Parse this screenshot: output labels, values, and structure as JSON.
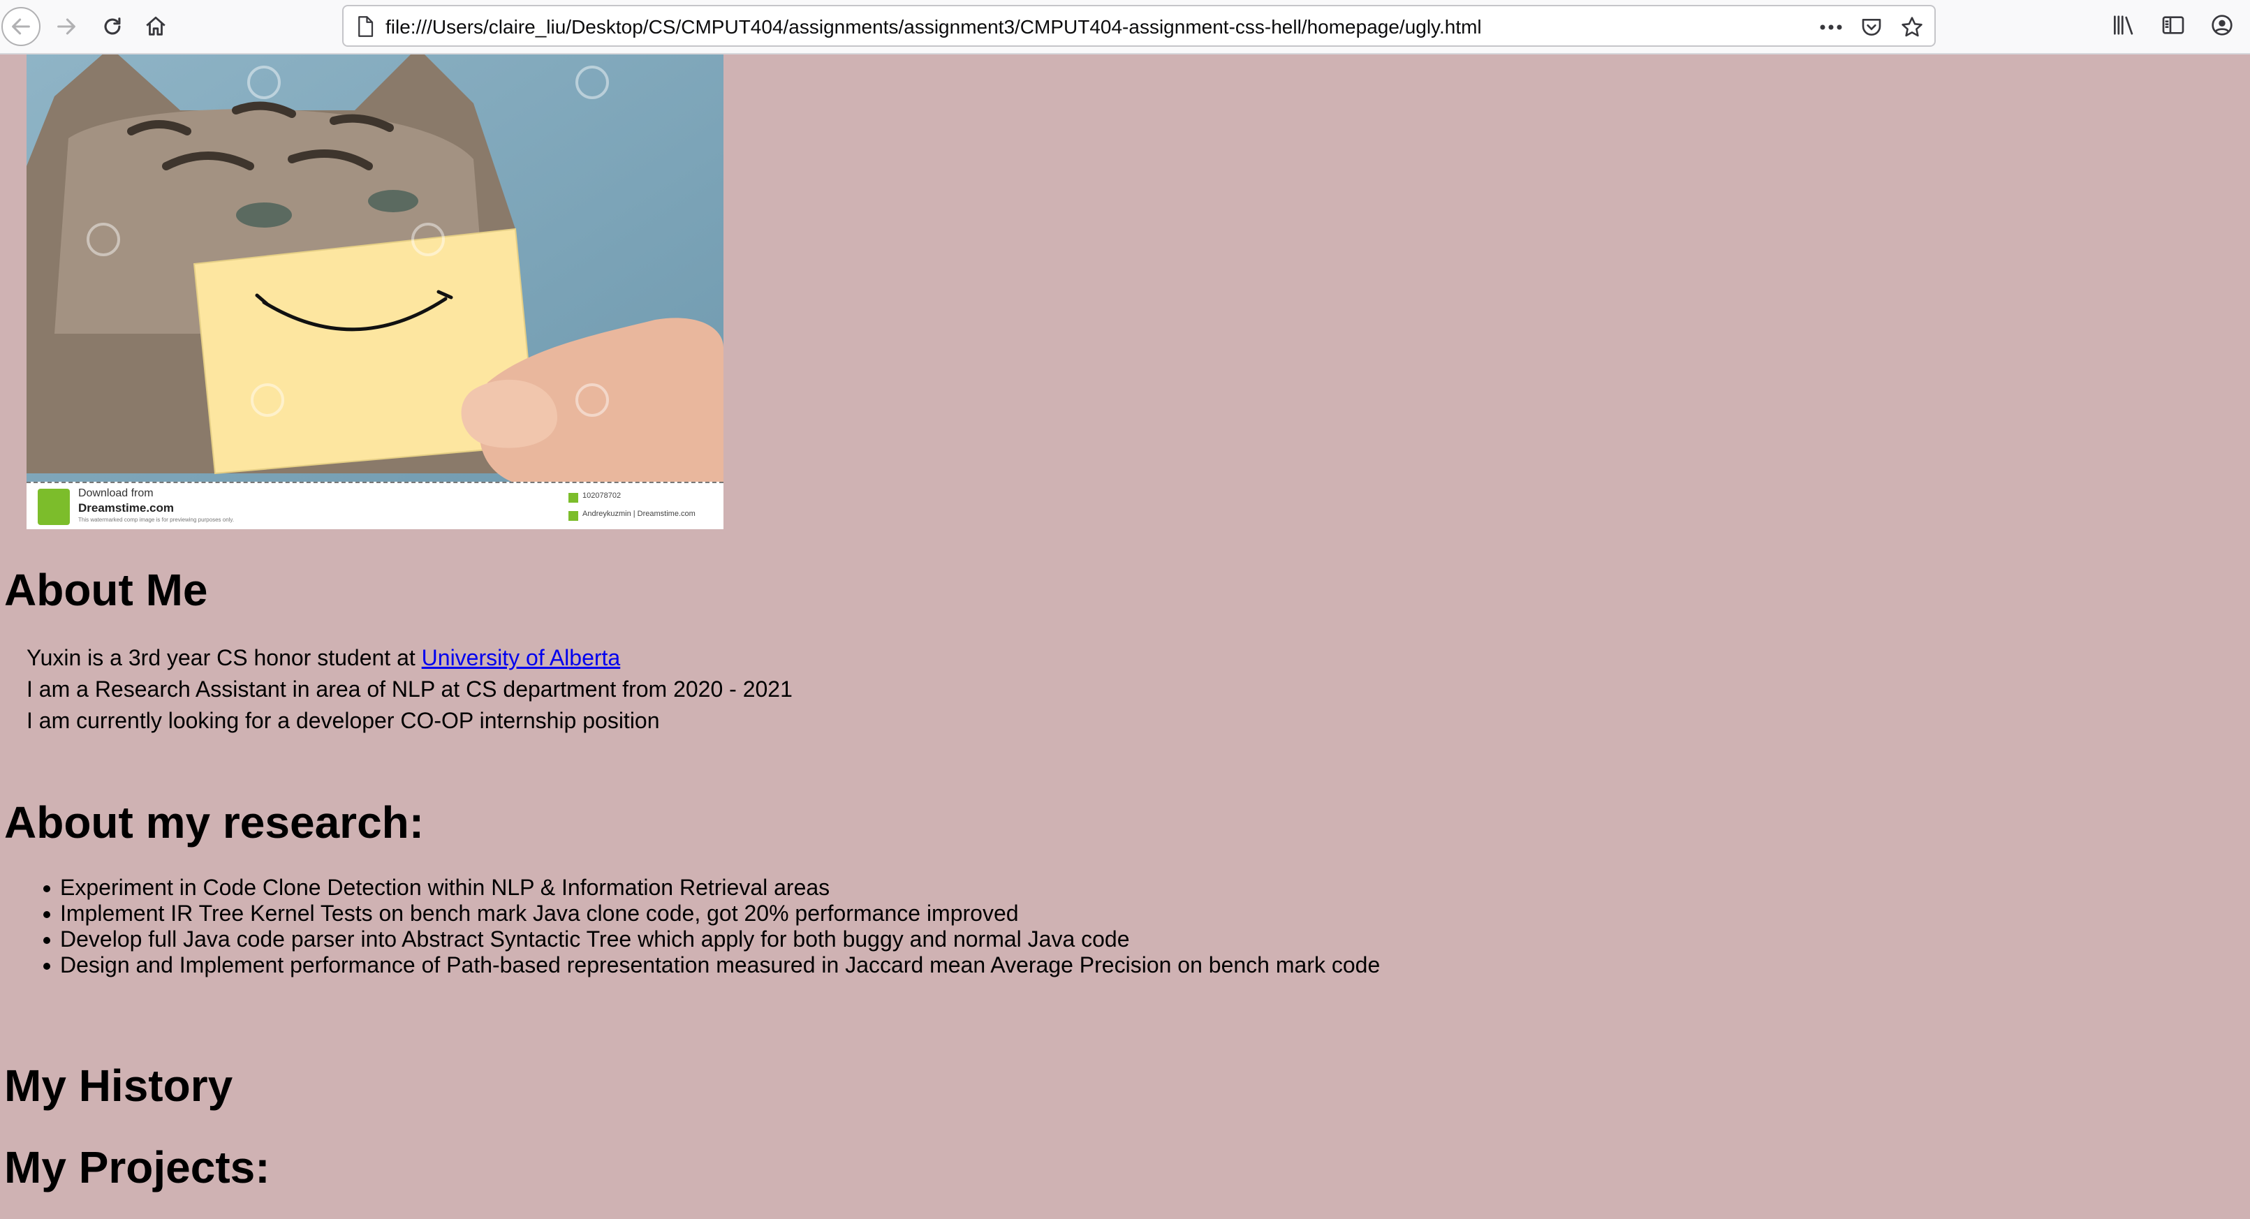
{
  "browser": {
    "url": "file:///Users/claire_liu/Desktop/CS/CMPUT404/assignments/assignment3/CMPUT404-assignment-css-hell/homepage/ugly.html",
    "icons": [
      "back-arrow-icon",
      "forward-arrow-icon",
      "reload-icon",
      "home-icon",
      "page-icon",
      "more-dots-icon",
      "pocket-icon",
      "bookmark-star-icon",
      "library-icon",
      "sidebar-icon",
      "account-icon"
    ]
  },
  "hero_image": {
    "watermark_line1": "Download from",
    "watermark_line2": "Dreamstime.com",
    "watermark_line3": "This watermarked comp image is for previewing purposes only.",
    "image_id": "102078702",
    "credit": "Andreykuzmin | Dreamstime.com"
  },
  "about": {
    "title": "About Me",
    "line1_prefix": "Yuxin is a 3rd year CS honor student at ",
    "line1_link": "University of Alberta",
    "line2": "I am a Research Assistant in area of NLP at CS department from 2020 - 2021",
    "line3": "I am currently looking for a developer CO-OP internship position"
  },
  "research": {
    "title": "About my research:",
    "items": [
      "Experiment in Code Clone Detection within NLP & Information Retrieval areas",
      "Implement IR Tree Kernel Tests on bench mark Java clone code, got 20% performance improved",
      "Develop full Java code parser into Abstract Syntactic Tree which apply for both buggy and normal Java code",
      "Design and Implement performance of Path-based representation measured in Jaccard mean Average Precision on bench mark code"
    ]
  },
  "history": {
    "title": "My History"
  },
  "projects": {
    "title": "My Projects:"
  },
  "colors": {
    "page_background": "#cfb2b3",
    "link": "#0000ee"
  }
}
